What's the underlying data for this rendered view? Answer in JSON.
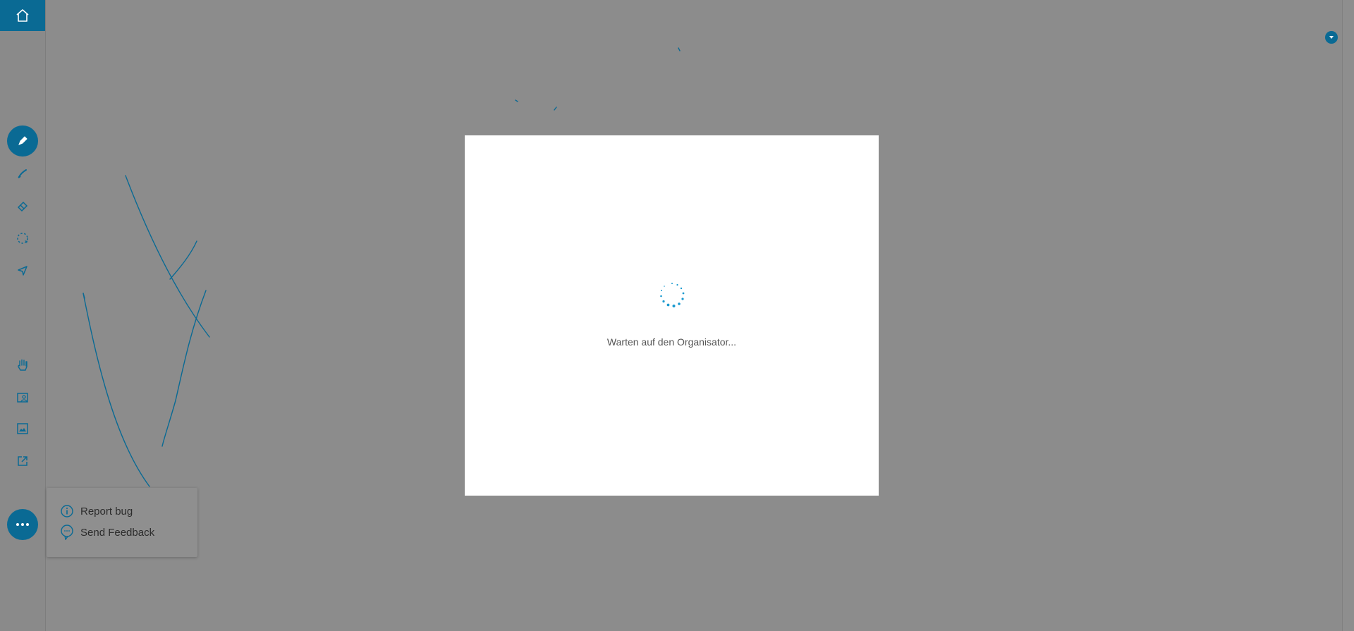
{
  "sidebar": {
    "tools": [
      {
        "name": "pen-icon",
        "active": true
      },
      {
        "name": "highlighter-icon",
        "active": false
      },
      {
        "name": "eraser-icon",
        "active": false
      },
      {
        "name": "lasso-icon",
        "active": false
      },
      {
        "name": "pointer-icon",
        "active": false
      },
      {
        "name": "hand-icon",
        "active": false
      },
      {
        "name": "add-image-icon",
        "active": false
      },
      {
        "name": "image-icon",
        "active": false
      },
      {
        "name": "share-icon",
        "active": false
      }
    ],
    "more_icon": "ellipsis-icon"
  },
  "dialog": {
    "message": "Warten auf den Organisator..."
  },
  "menu": {
    "items": [
      {
        "label": "Report bug",
        "icon": "info-icon"
      },
      {
        "label": "Send Feedback",
        "icon": "feedback-icon"
      }
    ]
  },
  "colors": {
    "accent": "#0a6a94",
    "overlay": "#8c8c8c",
    "spinner": "#1a9ad0"
  }
}
